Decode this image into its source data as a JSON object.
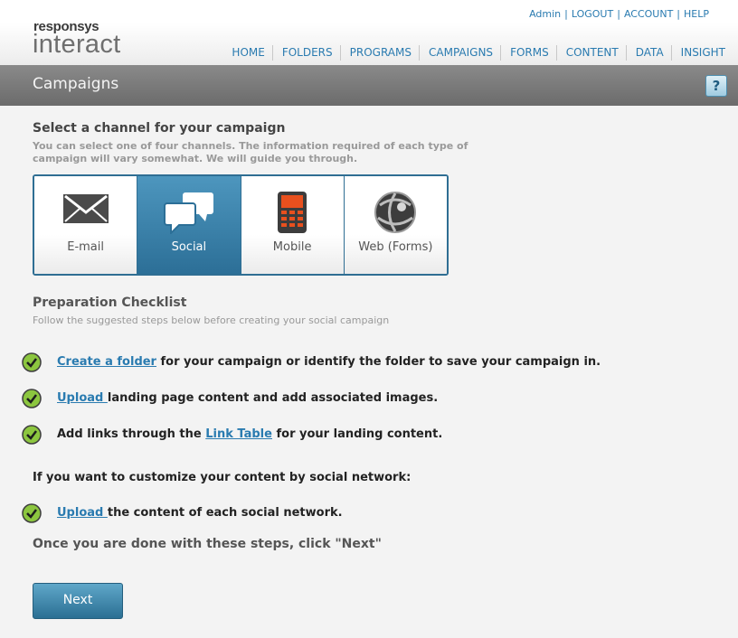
{
  "header": {
    "logo_top": "responsys",
    "logo_main": "interact",
    "util_links": [
      "Admin",
      "LOGOUT",
      "ACCOUNT",
      "HELP"
    ],
    "nav": [
      "HOME",
      "FOLDERS",
      "PROGRAMS",
      "CAMPAIGNS",
      "FORMS",
      "CONTENT",
      "DATA",
      "INSIGHT"
    ]
  },
  "titlebar": {
    "title": "Campaigns",
    "help_label": "?"
  },
  "select": {
    "heading": "Select a channel for your campaign",
    "subtext": "You can select one of four channels. The information required of each type of campaign will vary somewhat. We will guide you through."
  },
  "channels": [
    {
      "label": "E-mail",
      "icon": "envelope-icon",
      "selected": false
    },
    {
      "label": "Social",
      "icon": "speech-bubbles-icon",
      "selected": true
    },
    {
      "label": "Mobile",
      "icon": "mobile-phone-icon",
      "selected": false
    },
    {
      "label": "Web (Forms)",
      "icon": "globe-icon",
      "selected": false
    }
  ],
  "checklist": {
    "heading": "Preparation Checklist",
    "subtext": "Follow the suggested steps below before creating your social campaign",
    "items": [
      {
        "link": "Create a folder",
        "after": " for your campaign or identify the folder to save your campaign in."
      },
      {
        "link": "Upload ",
        "after": "landing page content and add associated images."
      },
      {
        "before": "Add links through the ",
        "link": "Link Table",
        "after": " for your landing content."
      }
    ],
    "custom_heading": "If you want to customize your content by social network:",
    "custom_item": {
      "link": "Upload ",
      "after": "the content of each social network."
    },
    "done_text": "Once you are done with these steps, click \"Next\""
  },
  "next_label": "Next",
  "colors": {
    "accent": "#2a7bb0",
    "active_channel": "#2c6f97",
    "check_green": "#8cc63f"
  }
}
